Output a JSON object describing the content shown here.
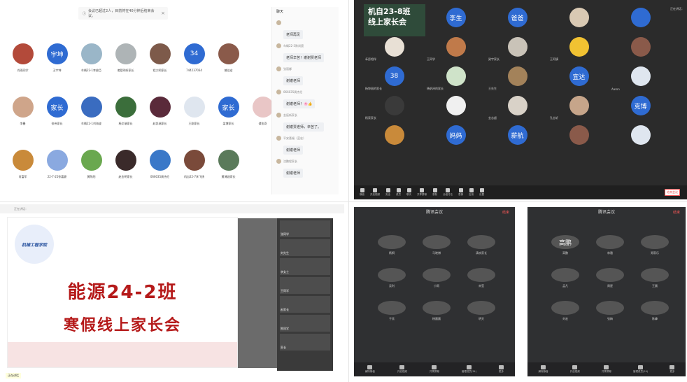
{
  "p1": {
    "notice": "会议已超过2人，目前将在40分钟后结束会议。",
    "chat_title": "聊天",
    "participants": [
      {
        "name": "肖雨同学",
        "avatar": "",
        "color": "#b34a3a"
      },
      {
        "name": "王宇坤",
        "avatar": "宇坤",
        "color": "#2f6bd2"
      },
      {
        "name": "车辆22-1李俊臣",
        "avatar": "",
        "color": "#9ab6c8"
      },
      {
        "name": "诸葛明轩家长",
        "avatar": "",
        "color": "#aeb4b6"
      },
      {
        "name": "程大明家长",
        "avatar": "",
        "color": "#7d5a4a"
      },
      {
        "name": "744237034",
        "avatar": "34",
        "color": "#2f6bd2"
      },
      {
        "name": "曾佳宏",
        "avatar": "",
        "color": "#8a5a4a"
      },
      {
        "name": "",
        "avatar": "",
        "color": "#ffffff"
      },
      {
        "name": "",
        "avatar": "",
        "color": "#ffffff"
      },
      {
        "name": "李曼",
        "avatar": "",
        "color": "#cfa58a"
      },
      {
        "name": "张伟家长",
        "avatar": "家长",
        "color": "#2f6bd2"
      },
      {
        "name": "车辆22-1刘海波",
        "avatar": "",
        "color": "#3a6cc0"
      },
      {
        "name": "杨文瑞家长",
        "avatar": "",
        "color": "#3b6e3b"
      },
      {
        "name": "赵凯瑞家长",
        "avatar": "",
        "color": "#5a2a3a"
      },
      {
        "name": "王刚家长",
        "avatar": "",
        "color": "#dfe6ef"
      },
      {
        "name": "梁博家长",
        "avatar": "家长",
        "color": "#2f6bd2"
      },
      {
        "name": "谭金奇",
        "avatar": "",
        "color": "#e9c6c6"
      },
      {
        "name": "",
        "avatar": "",
        "color": "#ffffff"
      },
      {
        "name": "肖富军",
        "avatar": "",
        "color": "#c98a3a"
      },
      {
        "name": "22-7-25徐嘉豪",
        "avatar": "",
        "color": "#8aa9e0"
      },
      {
        "name": "黄陈阳",
        "avatar": "",
        "color": "#6aa84f"
      },
      {
        "name": "赵金明家长",
        "avatar": "",
        "color": "#3a2a2a"
      },
      {
        "name": "066035周杰伦",
        "avatar": "",
        "color": "#3a78c8"
      },
      {
        "name": "机自22-7李飞扬",
        "avatar": "",
        "color": "#7a4a3a"
      },
      {
        "name": "黄博涵家长",
        "avatar": "",
        "color": "#5a7a5a"
      }
    ],
    "chat": [
      {
        "sender": "",
        "text": "老师再见"
      },
      {
        "sender": "车辆22-3陈尚宸",
        "text": "老师辛苦！谢谢贾老师"
      },
      {
        "sender": "张丽娜",
        "text": "谢谢老师"
      },
      {
        "sender": "066035周杰伦",
        "text": "谢谢老师！🌸👍"
      },
      {
        "sender": "金辰新家长",
        "text": "谢谢贾老师，辛苦了。"
      },
      {
        "sender": "平安喜福（蓝宏）",
        "text": "谢谢老师"
      },
      {
        "sender": "沈鹏程家长",
        "text": "谢谢老师"
      }
    ]
  },
  "p2": {
    "banner_line1": "机自23-8班",
    "banner_line2": "线上家长会",
    "top_right": "正在讲话：",
    "tiles": [
      {
        "label": "",
        "avatar": "",
        "color": "#2f4b3a"
      },
      {
        "label": "",
        "avatar": "李生",
        "color": "#2f6bd2"
      },
      {
        "label": "",
        "avatar": "爸爸",
        "color": "#2f6bd2"
      },
      {
        "label": "",
        "avatar": "",
        "color": "#d9c9b3"
      },
      {
        "label": "",
        "avatar": "",
        "color": "#2f6bd2"
      },
      {
        "label": "禾愿相伴",
        "avatar": "",
        "color": "#e8e0d5"
      },
      {
        "label": "王同学",
        "avatar": "",
        "color": "#c07a4a"
      },
      {
        "label": "梁宇家长",
        "avatar": "",
        "color": "#c9c3b8"
      },
      {
        "label": "王阿姨",
        "avatar": "",
        "color": "#f1c232"
      },
      {
        "label": "",
        "avatar": "",
        "color": "#8a5a4a"
      },
      {
        "label": "杨坤丽的家长",
        "avatar": "38",
        "color": "#2f6bd2"
      },
      {
        "label": "杨帆泽的家长",
        "avatar": "",
        "color": "#cfe3c9"
      },
      {
        "label": "王先生",
        "avatar": "",
        "color": "#a3825a"
      },
      {
        "label": "",
        "avatar": "宜达",
        "color": "#2f6bd2"
      },
      {
        "label": "Aaron",
        "avatar": "",
        "color": "#dfe6ef"
      },
      {
        "label": "杨家家长",
        "avatar": "",
        "color": "#3a3a3a"
      },
      {
        "label": "",
        "avatar": "",
        "color": "#f0f0f0"
      },
      {
        "label": "金志超",
        "avatar": "",
        "color": "#d9d2c8"
      },
      {
        "label": "孔志轩",
        "avatar": "",
        "color": "#c6a58a"
      },
      {
        "label": "",
        "avatar": "克博",
        "color": "#2f6bd2"
      },
      {
        "label": "",
        "avatar": "",
        "color": "#c98a3a"
      },
      {
        "label": "",
        "avatar": "妈妈",
        "color": "#2f6bd2"
      },
      {
        "label": "",
        "avatar": "薪航",
        "color": "#2f6bd2"
      },
      {
        "label": "",
        "avatar": "",
        "color": "#8a5a4a"
      },
      {
        "label": "",
        "avatar": "",
        "color": "#dfe6ef"
      }
    ],
    "toolbar": [
      "静音",
      "开启视频",
      "安全",
      "成员",
      "聊天",
      "共享屏幕",
      "录制",
      "分组讨论",
      "表情",
      "应用",
      "设置"
    ],
    "leave": "结束会议"
  },
  "p3": {
    "bar_text": "正在讲话：",
    "logo": "机械工程学院",
    "title_line1": "能源24-2班",
    "title_line2": "寒假线上家长会",
    "footer_label": "正在讲话",
    "side_videos": [
      "张同学",
      "刘先生",
      "李女士",
      "王同学",
      "赵家长",
      "陈同学",
      "家长"
    ]
  },
  "p4": {
    "header": "腾讯会议",
    "leave": "结束",
    "people": [
      {
        "name": "杨桐",
        "avatar": ""
      },
      {
        "name": "马晓博",
        "avatar": ""
      },
      {
        "name": "清欢家长",
        "avatar": ""
      },
      {
        "name": "吴利",
        "avatar": ""
      },
      {
        "name": "小雨",
        "avatar": ""
      },
      {
        "name": "宋莹",
        "avatar": ""
      },
      {
        "name": "于欣",
        "avatar": ""
      },
      {
        "name": "杨晨晨",
        "avatar": ""
      },
      {
        "name": "明天",
        "avatar": ""
      }
    ],
    "bar": [
      "解除静音",
      "开启视频",
      "共享屏幕",
      "管理成员(34)",
      "更多"
    ]
  },
  "p5": {
    "header": "腾讯会议",
    "leave": "结束",
    "people": [
      {
        "name": "高鹏",
        "avatar": "高鹏"
      },
      {
        "name": "林雅",
        "avatar": ""
      },
      {
        "name": "郑家乐",
        "avatar": ""
      },
      {
        "name": "孟凡",
        "avatar": ""
      },
      {
        "name": "周星",
        "avatar": ""
      },
      {
        "name": "王晨",
        "avatar": ""
      },
      {
        "name": "刘宏",
        "avatar": ""
      },
      {
        "name": "张梅",
        "avatar": ""
      },
      {
        "name": "陈峰",
        "avatar": ""
      }
    ],
    "bar": [
      "解除静音",
      "开启视频",
      "共享屏幕",
      "管理成员(29)",
      "更多"
    ]
  }
}
